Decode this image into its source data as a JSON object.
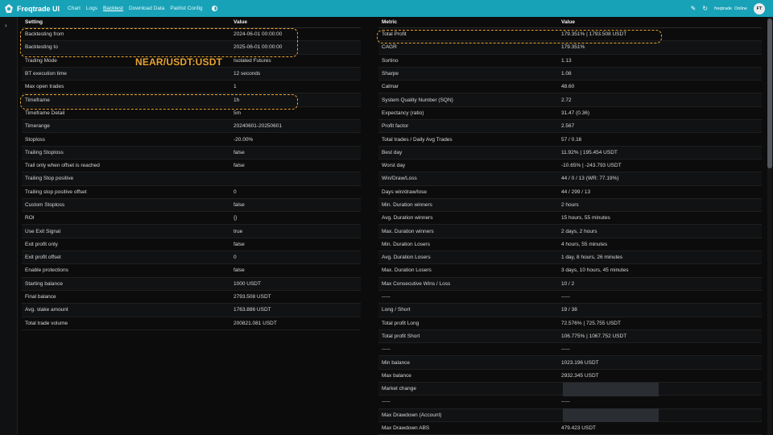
{
  "app": {
    "title": "Freqtrade UI"
  },
  "nav": {
    "links": [
      "Chart",
      "Logs",
      "Backtest",
      "Download Data",
      "Pairlist Config"
    ],
    "bot_name": "freqtrade",
    "bot_status": "Online",
    "avatar_initials": "FT"
  },
  "annotation": {
    "pair": "NEAR/USDT:USDT"
  },
  "settings": {
    "headers": [
      "Setting",
      "Value"
    ],
    "rows": [
      [
        "Backtesting from",
        "2024-06-01 00:00:00"
      ],
      [
        "Backtesting to",
        "2025-06-01 00:00:00"
      ],
      [
        "Trading Mode",
        "Isolated Futures"
      ],
      [
        "BT execution time",
        "12 seconds"
      ],
      [
        "Max open trades",
        "1"
      ],
      [
        "Timeframe",
        "1h"
      ],
      [
        "Timeframe Detail",
        "5m"
      ],
      [
        "Timerange",
        "20240601-20250601"
      ],
      [
        "Stoploss",
        "-20.00%"
      ],
      [
        "Trailing Stoploss",
        "false"
      ],
      [
        "Trail only when offset is reached",
        "false"
      ],
      [
        "Trailing Stop positive",
        ""
      ],
      [
        "Trailing stop positive offset",
        "0"
      ],
      [
        "Custom Stoploss",
        "false"
      ],
      [
        "ROI",
        "{}"
      ],
      [
        "Use Exit Signal",
        "true"
      ],
      [
        "Exit profit only",
        "false"
      ],
      [
        "Exit profit offset",
        "0"
      ],
      [
        "Enable protections",
        "false"
      ],
      [
        "Starting balance",
        "1000 USDT"
      ],
      [
        "Final balance",
        "2793.508 USDT"
      ],
      [
        "Avg. stake amount",
        "1763.886 USDT"
      ],
      [
        "Total trade volume",
        "200821.081 USDT"
      ]
    ]
  },
  "metrics": {
    "headers": [
      "Metric",
      "Value"
    ],
    "rows": [
      [
        "Total Profit",
        "179.351% | 1793.508 USDT"
      ],
      [
        "CAGR",
        "179.351%"
      ],
      [
        "Sortino",
        "1.13"
      ],
      [
        "Sharpe",
        "1.08"
      ],
      [
        "Calmar",
        "48.60"
      ],
      [
        "System Quality Number (SQN)",
        "2.72"
      ],
      [
        "Expectancy (ratio)",
        "31.47 (0.36)"
      ],
      [
        "Profit factor",
        "2.567"
      ],
      [
        "Total trades / Daily Avg Trades",
        "57 / 0.16"
      ],
      [
        "Best day",
        "11.92% | 195.454 USDT"
      ],
      [
        "Worst day",
        "-10.65% | -243.793 USDT"
      ],
      [
        "Win/Draw/Loss",
        "44 / 0 / 13 (WR: 77.19%)"
      ],
      [
        "Days win/draw/lose",
        "44 / 299 / 13"
      ],
      [
        "Min. Duration winners",
        "2 hours"
      ],
      [
        "Avg. Duration winners",
        "15 hours, 55 minutes"
      ],
      [
        "Max. Duration winners",
        "2 days, 2 hours"
      ],
      [
        "Min. Duration Losers",
        "4 hours, 55 minutes"
      ],
      [
        "Avg. Duration Losers",
        "1 day, 8 hours, 26 minutes"
      ],
      [
        "Max. Duration Losers",
        "3 days, 10 hours, 45 minutes"
      ],
      [
        "Max Consecutive Wins / Loss",
        "10 / 2"
      ],
      [
        "-----",
        "-----"
      ],
      [
        "Long / Short",
        "19 / 38"
      ],
      [
        "Total profit Long",
        "72.576% | 725.755 USDT"
      ],
      [
        "Total profit Short",
        "106.775% | 1067.752 USDT"
      ],
      [
        "-----",
        "-----"
      ],
      [
        "Min balance",
        "1023.196 USDT"
      ],
      [
        "Max balance",
        "2932.345 USDT"
      ],
      [
        "Market change",
        ""
      ],
      [
        "-----",
        "-----"
      ],
      [
        "Max Drawdown (Account)",
        ""
      ],
      [
        "Max Drawdown ABS",
        "479.423 USDT"
      ]
    ]
  },
  "colors": {
    "navbar": "#17a2b8",
    "highlight": "#e8a330",
    "background": "#0c0c0d"
  }
}
